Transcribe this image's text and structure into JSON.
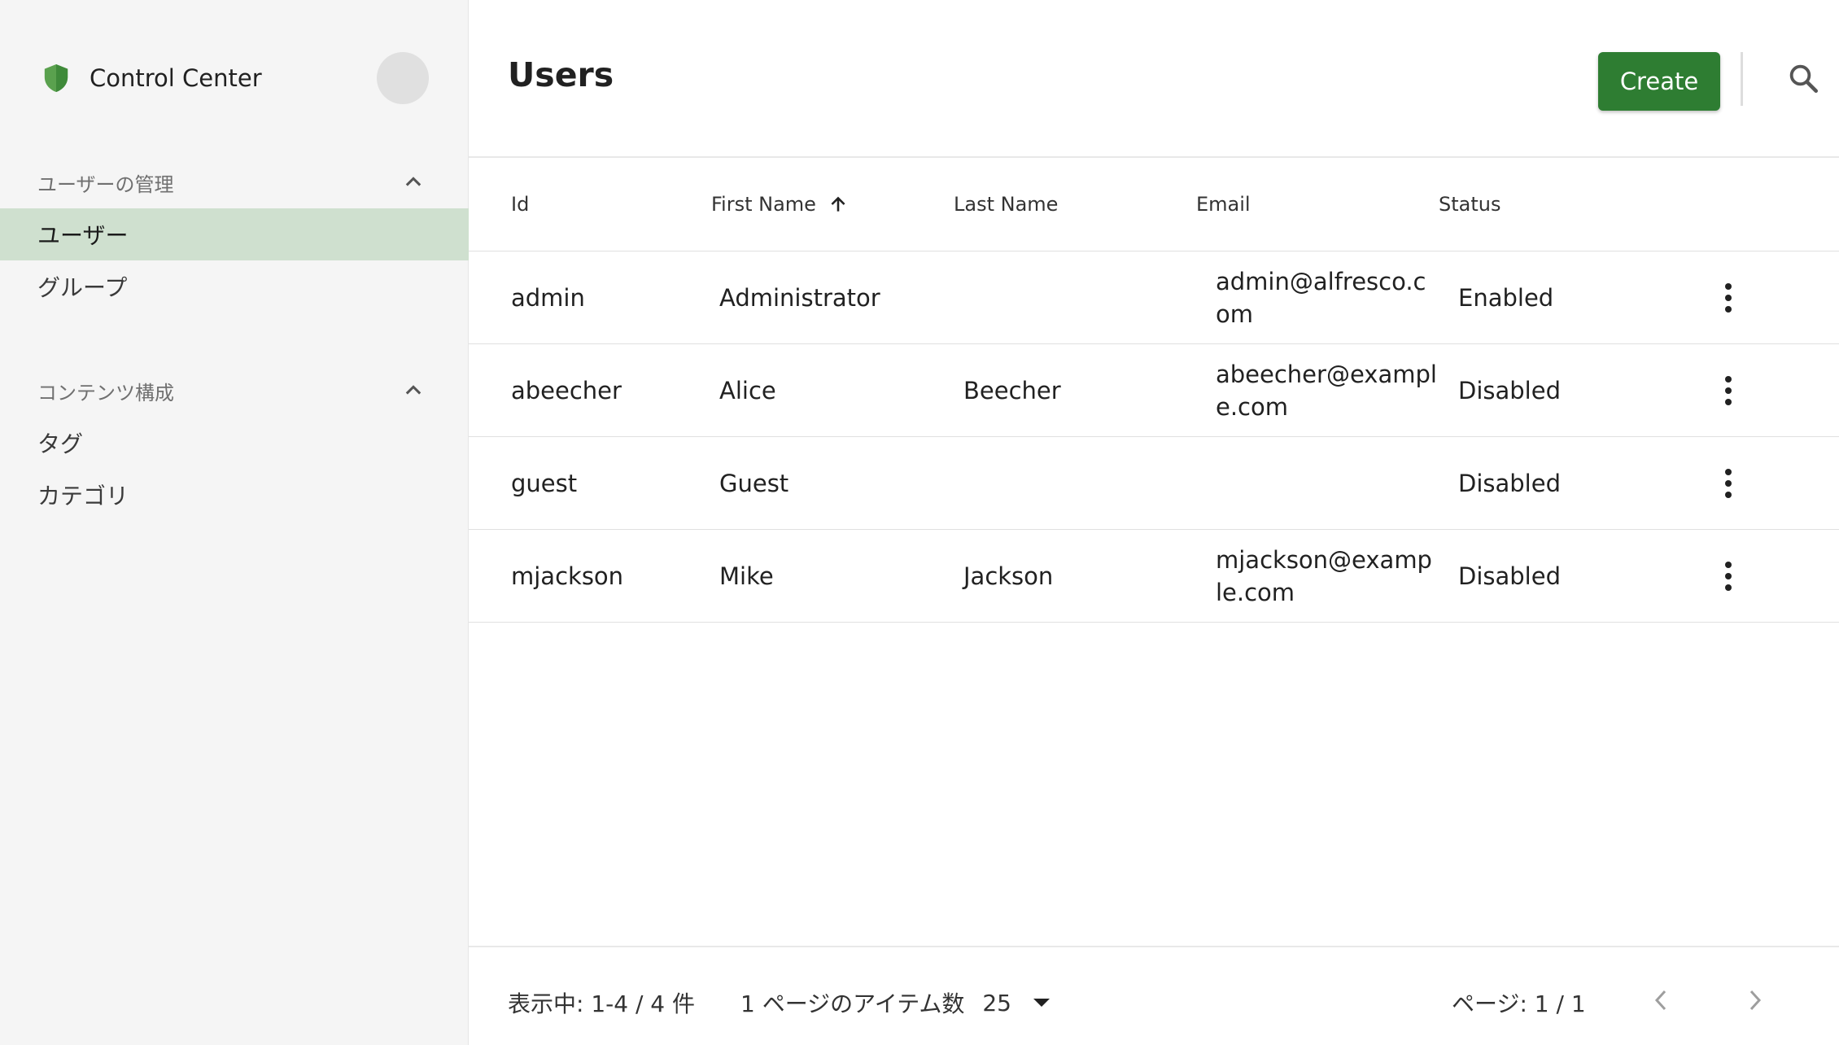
{
  "app": {
    "title": "Control Center"
  },
  "sidebar": {
    "sections": [
      {
        "label": "ユーザーの管理",
        "items": [
          {
            "label": "ユーザー",
            "active": true
          },
          {
            "label": "グループ"
          }
        ]
      },
      {
        "label": "コンテンツ構成",
        "items": [
          {
            "label": "タグ"
          },
          {
            "label": "カテゴリ"
          }
        ]
      }
    ]
  },
  "header": {
    "title": "Users",
    "create_label": "Create"
  },
  "table": {
    "columns": [
      "Id",
      "First Name",
      "Last Name",
      "Email",
      "Status"
    ],
    "sort": {
      "column": "First Name",
      "direction": "ascending"
    },
    "rows": [
      {
        "id": "admin",
        "first": "Administrator",
        "last": "",
        "email": "admin@alfresco.com",
        "status": "Enabled"
      },
      {
        "id": "abeecher",
        "first": "Alice",
        "last": "Beecher",
        "email": "abeecher@example.com",
        "status": "Disabled"
      },
      {
        "id": "guest",
        "first": "Guest",
        "last": "",
        "email": "",
        "status": "Disabled"
      },
      {
        "id": "mjackson",
        "first": "Mike",
        "last": "Jackson",
        "email": "mjackson@example.com",
        "status": "Disabled"
      }
    ]
  },
  "paginator": {
    "range": "表示中: 1-4 / 4 件",
    "per_page_label": "1 ページのアイテム数",
    "per_page_value": "25",
    "page": "ページ: 1 / 1"
  },
  "colors": {
    "accent": "#2e7d32",
    "active_nav": "#cfe0cf",
    "shield": "#5aa14e"
  }
}
